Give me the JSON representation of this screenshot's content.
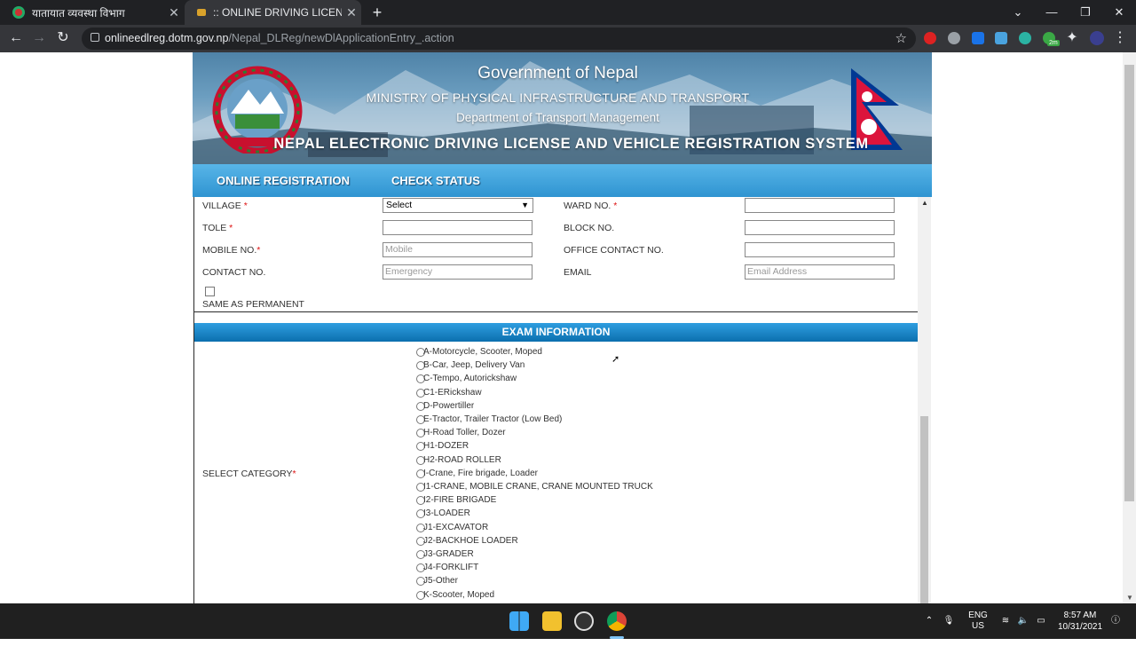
{
  "browser": {
    "tabs": [
      {
        "label": "यातायात व्यवस्था विभाग",
        "active": false
      },
      {
        "label": ":: ONLINE DRIVING LICENSE ::",
        "active": true
      }
    ],
    "url_host": "onlineedlreg.dotm.gov.np",
    "url_path": "/Nepal_DLReg/newDlApplicationEntry_.action"
  },
  "banner": {
    "line1": "Government of Nepal",
    "line2": "MINISTRY OF PHYSICAL INFRASTRUCTURE AND TRANSPORT",
    "line3": "Department of Transport Management",
    "line4": "NEPAL ELECTRONIC DRIVING LICENSE AND VEHICLE REGISTRATION SYSTEM"
  },
  "menu": {
    "online_registration": "ONLINE REGISTRATION",
    "check_status": "CHECK STATUS"
  },
  "address": {
    "village_label": "VILLAGE",
    "village_value": "Select",
    "ward_label": "WARD NO.",
    "tole_label": "TOLE",
    "block_label": "BLOCK NO.",
    "mobile_label": "MOBILE NO.",
    "mobile_placeholder": "Mobile",
    "office_contact_label": "OFFICE CONTACT NO.",
    "contact_label": "CONTACT NO.",
    "contact_placeholder": "Emergency",
    "email_label": "EMAIL",
    "email_placeholder": "Email Address",
    "same_as_permanent": "SAME AS PERMANENT",
    "required_mark": "*"
  },
  "exam": {
    "header": "EXAM INFORMATION",
    "select_category_label": "SELECT CATEGORY",
    "categories": [
      "A-Motorcycle, Scooter, Moped",
      "B-Car, Jeep, Delivery Van",
      "C-Tempo, Autorickshaw",
      "C1-ERickshaw",
      "D-Powertiller",
      "E-Tractor, Trailer Tractor (Low Bed)",
      "H-Road Toller, Dozer",
      "H1-DOZER",
      "H2-ROAD ROLLER",
      "I-Crane, Fire brigade, Loader",
      "I1-CRANE, MOBILE CRANE, CRANE MOUNTED TRUCK",
      "I2-FIRE BRIGADE",
      "I3-LOADER",
      "J1-EXCAVATOR",
      "J2-BACKHOE LOADER",
      "J3-GRADER",
      "J4-FORKLIFT",
      "J5-Other",
      "K-Scooter, Moped"
    ]
  },
  "taskbar": {
    "lang_line1": "ENG",
    "lang_line2": "US",
    "time": "8:57 AM",
    "date": "10/31/2021"
  },
  "extension_badge": "2m"
}
